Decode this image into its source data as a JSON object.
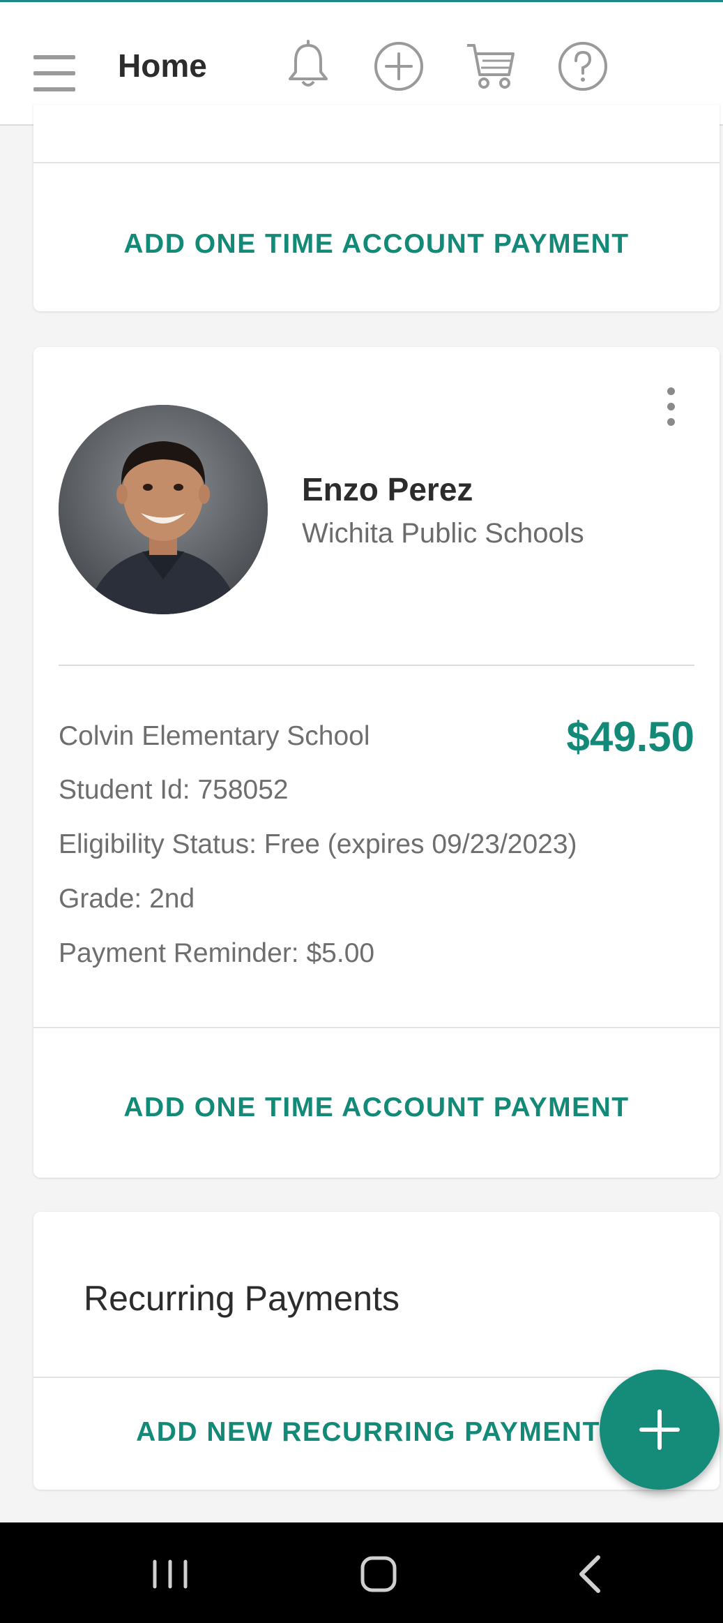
{
  "header": {
    "title": "Home",
    "icons": [
      "menu-icon",
      "bell-icon",
      "plus-circle-icon",
      "cart-icon",
      "help-icon"
    ]
  },
  "cards": {
    "top_card": {
      "action_label": "ADD ONE TIME ACCOUNT PAYMENT"
    },
    "student": {
      "name": "Enzo Perez",
      "district": "Wichita Public Schools",
      "school": "Colvin Elementary School",
      "balance": "$49.50",
      "student_id": "Student Id: 758052",
      "eligibility": "Eligibility Status: Free (expires 09/23/2023)",
      "grade": "Grade: 2nd",
      "payment_reminder": "Payment Reminder: $5.00",
      "action_label": "ADD ONE TIME ACCOUNT PAYMENT"
    },
    "recurring": {
      "title": "Recurring Payments",
      "action_label": "ADD NEW RECURRING PAYMENT"
    }
  },
  "colors": {
    "accent": "#138a78",
    "fab": "#158b7a",
    "nav_bar": "#000000"
  },
  "system_nav": {
    "buttons": [
      "recents-icon",
      "home-icon",
      "back-icon"
    ]
  }
}
